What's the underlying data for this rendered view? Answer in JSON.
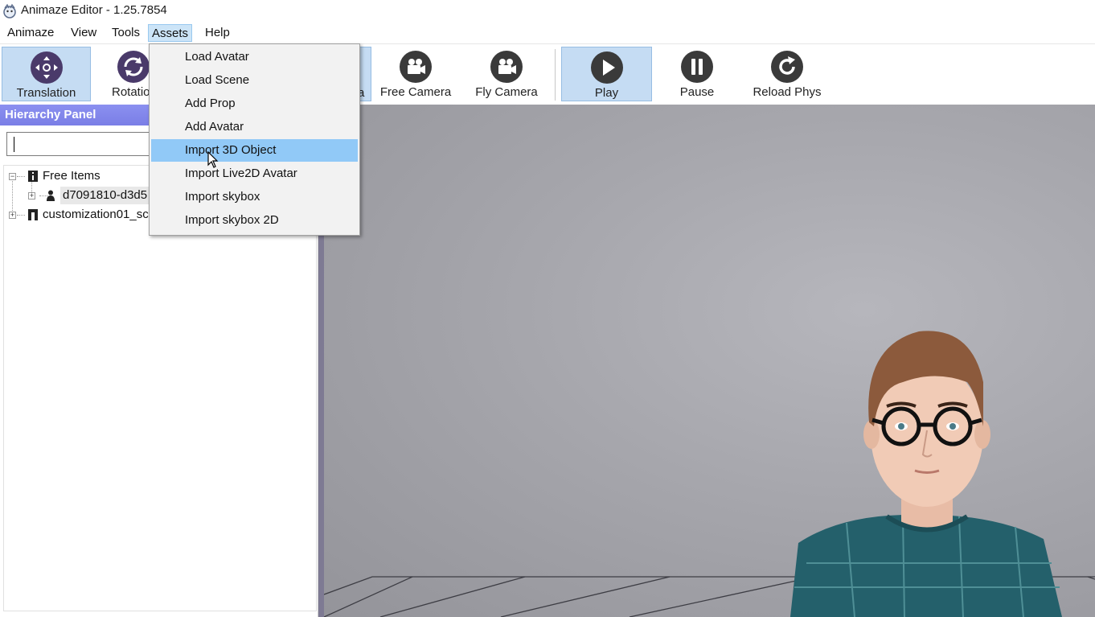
{
  "window": {
    "title": "Animaze Editor - 1.25.7854"
  },
  "menubar": {
    "items": [
      {
        "label": "Animaze"
      },
      {
        "label": "View"
      },
      {
        "label": "Tools"
      },
      {
        "label": "Assets"
      },
      {
        "label": "Help"
      }
    ],
    "active": "Assets"
  },
  "toolbar": {
    "tools": [
      {
        "label": "Translation",
        "icon": "translation-icon",
        "selected": true
      },
      {
        "label": "Rotatio",
        "icon": "rotation-icon",
        "selected": false
      },
      {
        "label": "a",
        "icon": "camera-icon",
        "selected": true
      },
      {
        "label": "Free Camera",
        "icon": "free-camera-icon",
        "selected": false
      },
      {
        "label": "Fly Camera",
        "icon": "fly-camera-icon",
        "selected": false
      },
      {
        "label": "Play",
        "icon": "play-icon",
        "selected": true
      },
      {
        "label": "Pause",
        "icon": "pause-icon",
        "selected": false
      },
      {
        "label": "Reload Phys",
        "icon": "reload-icon",
        "selected": false
      }
    ]
  },
  "hierarchy": {
    "title": "Hierarchy Panel",
    "search_value": "",
    "tree": [
      {
        "label": "Free Items",
        "expanded": true,
        "icon": "info-icon"
      },
      {
        "label": "d7091810-d3d5",
        "expanded": false,
        "icon": "person-icon"
      },
      {
        "label": "customization01_sc",
        "expanded": false,
        "icon": "scene-icon"
      }
    ]
  },
  "assets_menu": {
    "items": [
      {
        "label": "Load Avatar"
      },
      {
        "label": "Load Scene"
      },
      {
        "label": "Add Prop"
      },
      {
        "label": "Add Avatar"
      },
      {
        "label": "Import 3D Object"
      },
      {
        "label": "Import Live2D Avatar"
      },
      {
        "label": "Import skybox"
      },
      {
        "label": "Import skybox 2D"
      }
    ],
    "hovered": "Import 3D Object"
  },
  "colors": {
    "accent": "#91c9f7",
    "panel_header": "#7a7ee6",
    "tool_selected": "#c5dcf3",
    "icon_fill": "#3a3a3a"
  }
}
